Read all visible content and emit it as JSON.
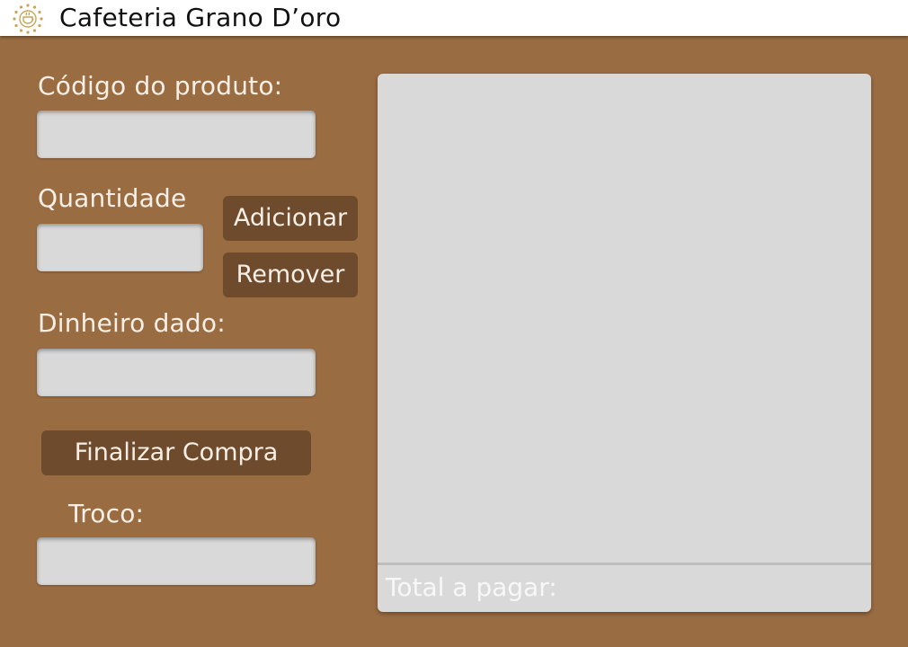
{
  "app": {
    "title": "Cafeteria Grano D’oro",
    "logo_icon": "sun-coffee-cup-icon",
    "logo_color": "#c9a45a"
  },
  "colors": {
    "background": "#9a6c42",
    "button": "#6e4b2c",
    "field": "#d9d9d9",
    "text_light": "#f7efe6"
  },
  "form": {
    "product_code_label": "Código do produto:",
    "product_code_value": "",
    "quantity_label": "Quantidade",
    "quantity_value": "",
    "add_button": "Adicionar",
    "remove_button": "Remover",
    "cash_given_label": "Dinheiro dado:",
    "cash_given_value": "",
    "finish_button": "Finalizar Compra",
    "change_label": "Troco:",
    "change_value": ""
  },
  "cart": {
    "items": [],
    "total_label": "Total a pagar:",
    "total_value": ""
  }
}
